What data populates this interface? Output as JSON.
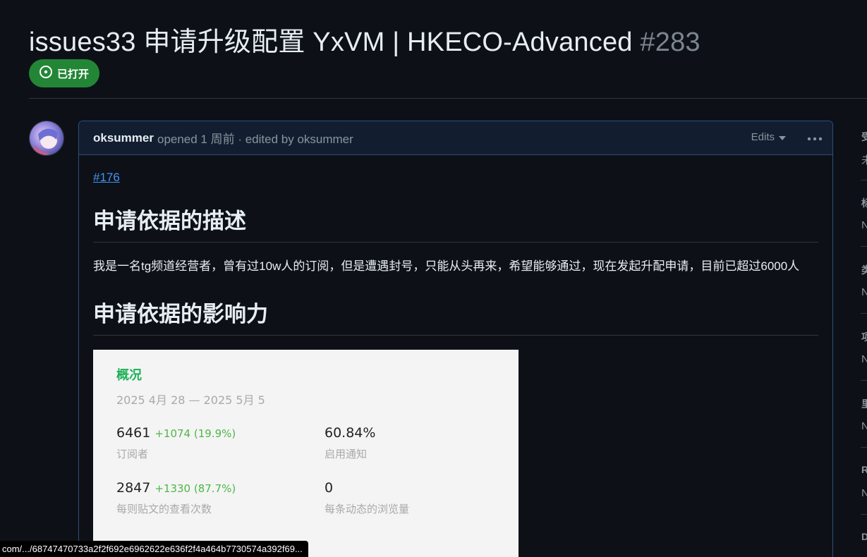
{
  "issue": {
    "title": "issues33 申请升级配置 YxVM | HKECO-Advanced",
    "number": "#283",
    "state_label": "已打开",
    "state_color": "#238636"
  },
  "comment": {
    "author": "oksummer",
    "meta": "opened 1 周前 · edited by oksummer",
    "edits_label": "Edits",
    "ref_link": "#176",
    "heading_1": "申请依据的描述",
    "paragraph": "我是一名tg频道经营者，曾有过10w人的订阅，但是遭遇封号，只能从头再来，希望能够通过，现在发起升配申请，目前已超过6000人",
    "heading_2": "申请依据的影响力"
  },
  "stats_card": {
    "title": "概况",
    "date_range": "2025 4月 28 — 2025 5月 5",
    "stats": [
      {
        "value": "6461",
        "delta": "+1074 (19.9%)",
        "label": "订阅者"
      },
      {
        "value": "60.84%",
        "delta": "",
        "label": "启用通知"
      },
      {
        "value": "2847",
        "delta": "+1330 (87.7%)",
        "label": "每则贴文的查看次数"
      },
      {
        "value": "0",
        "delta": "",
        "label": "每条动态的浏览量"
      }
    ]
  },
  "sidebar": {
    "items": [
      {
        "heading": "受",
        "value": "未"
      },
      {
        "heading": "标",
        "value": "N"
      },
      {
        "heading": "类",
        "value": "N"
      },
      {
        "heading": "项",
        "value": "N"
      },
      {
        "heading": "里",
        "value": "N"
      },
      {
        "heading": "R",
        "value": "N"
      },
      {
        "heading": "D",
        "value": ""
      }
    ]
  },
  "status_bar": {
    "url": "com/.../68747470733a2f2f692e6962622e636f2f4a464b7730574a392f69..."
  }
}
